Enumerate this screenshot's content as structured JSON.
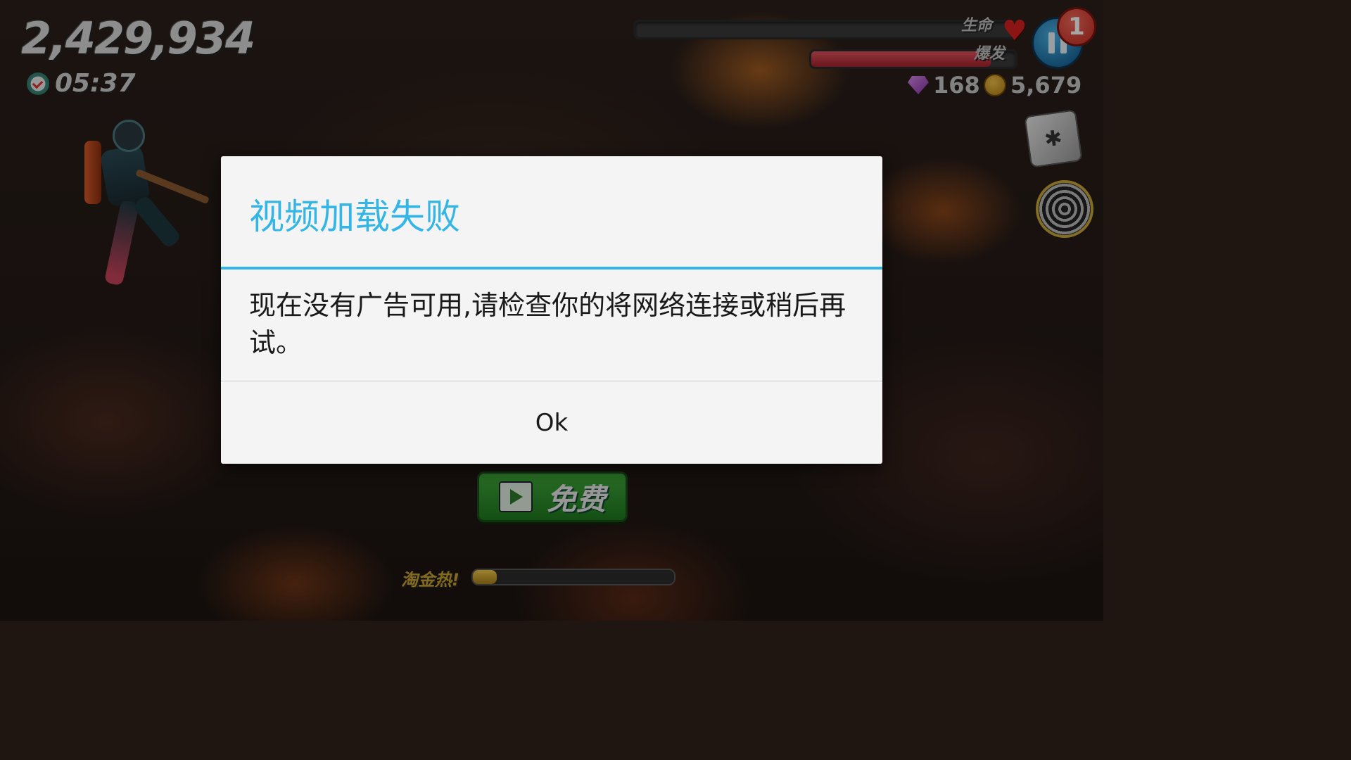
{
  "hud": {
    "score": "2,429,934",
    "timer": "05:37",
    "life_label": "生命",
    "burst_label": "爆发",
    "life_level": 0.0,
    "burst_level": 0.88,
    "notification_count": "1",
    "gems": "168",
    "coins": "5,679"
  },
  "dialog": {
    "title": "视频加载失败",
    "message": "现在没有广告可用,请检查你的将网络连接或稍后再试。",
    "ok_label": "Ok"
  },
  "free_button": {
    "label": "免费"
  },
  "gold_rush": {
    "label": "淘金热!",
    "progress": 0.12
  },
  "colors": {
    "dialog_accent": "#33b5e5",
    "free_button": "#2f9a2f",
    "burst_bar": "#c8303c"
  }
}
